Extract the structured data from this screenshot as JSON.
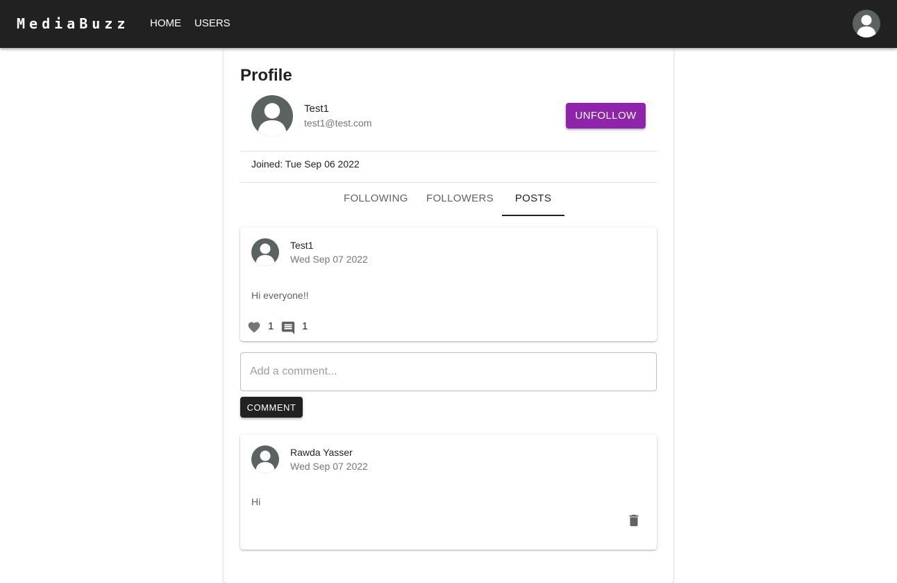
{
  "appbar": {
    "brand": "MediaBuzz",
    "nav": [
      {
        "label": "HOME"
      },
      {
        "label": "USERS"
      }
    ],
    "account_icon": "account-circle-icon"
  },
  "profile": {
    "title": "Profile",
    "name": "Test1",
    "email": "test1@test.com",
    "action_label": "UNFOLLOW",
    "joined": "Joined: Tue Sep 06 2022",
    "accent_color": "#8e24aa"
  },
  "tabs": [
    {
      "label": "FOLLOWING",
      "active": false
    },
    {
      "label": "FOLLOWERS",
      "active": false
    },
    {
      "label": "POSTS",
      "active": true
    }
  ],
  "post": {
    "author": "Test1",
    "date": "Wed Sep 07 2022",
    "text": "Hi everyone!!",
    "likes": "1",
    "comments": "1"
  },
  "comment_form": {
    "placeholder": "Add a comment...",
    "value": "",
    "button_label": "COMMENT"
  },
  "comments": [
    {
      "author": "Rawda Yasser",
      "date": "Wed Sep 07 2022",
      "text": "Hi"
    }
  ]
}
